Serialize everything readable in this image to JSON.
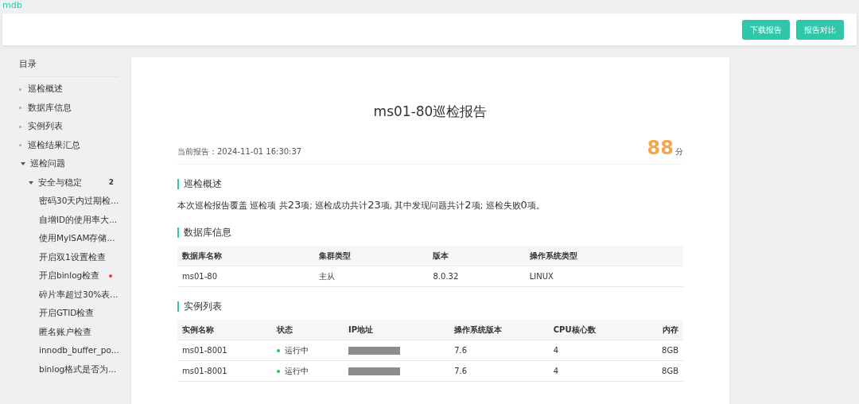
{
  "app_name": "mdb",
  "header_buttons": [
    "下载报告",
    "报告对比"
  ],
  "sidebar": {
    "title": "目录",
    "items": [
      {
        "label": "巡检概述",
        "kind": "leaf"
      },
      {
        "label": "数据库信息",
        "kind": "leaf"
      },
      {
        "label": "实例列表",
        "kind": "leaf"
      },
      {
        "label": "巡检结果汇总",
        "kind": "leaf"
      },
      {
        "label": "巡检问题",
        "kind": "group",
        "expanded": true,
        "children": [
          {
            "label": "安全与稳定",
            "kind": "group",
            "expanded": true,
            "count": "2",
            "children": [
              {
                "label": "密码30天内过期检...",
                "kind": "check",
                "alert": false
              },
              {
                "label": "自增ID的使用率大...",
                "kind": "check",
                "alert": false
              },
              {
                "label": "使用MyISAM存储...",
                "kind": "check",
                "alert": false
              },
              {
                "label": "开启双1设置检查",
                "kind": "check",
                "alert": false
              },
              {
                "label": "开启binlog检查",
                "kind": "check",
                "alert": true
              },
              {
                "label": "碎片率超过30%表...",
                "kind": "check",
                "alert": false
              },
              {
                "label": "开启GTID检查",
                "kind": "check",
                "alert": false
              },
              {
                "label": "匿名账户检查",
                "kind": "check",
                "alert": false
              },
              {
                "label": "innodb_buffer_po...",
                "kind": "check",
                "alert": false
              },
              {
                "label": "binlog格式是否为...",
                "kind": "check",
                "alert": false
              }
            ]
          }
        ]
      }
    ]
  },
  "report": {
    "title": "ms01-80巡检报告",
    "time_label": "当前报告：2024-11-01 16:30:37",
    "score": "88",
    "score_unit": "分",
    "sections": [
      {
        "kind": "summary",
        "heading": "巡检概述",
        "segments": [
          {
            "kind": "text",
            "text": "本次巡检报告覆盖 巡检项 共"
          },
          {
            "kind": "number",
            "text": "23"
          },
          {
            "kind": "text",
            "text": "项; 巡检成功共计"
          },
          {
            "kind": "number",
            "text": "23"
          },
          {
            "kind": "text",
            "text": "项, 其中发现问题共计"
          },
          {
            "kind": "number",
            "text": "2"
          },
          {
            "kind": "text",
            "text": "项; 巡检失败"
          },
          {
            "kind": "number",
            "text": "0"
          },
          {
            "kind": "text",
            "text": "项。"
          }
        ]
      },
      {
        "kind": "table",
        "heading": "数据库信息",
        "columns": [
          "数据库名称",
          "集群类型",
          "版本",
          "操作系统类型"
        ],
        "rows": [
          {
            "cells": [
              "ms01-80",
              "主从",
              "8.0.32",
              "LINUX"
            ]
          }
        ]
      },
      {
        "kind": "instances",
        "heading": "实例列表",
        "columns": [
          "实例名称",
          "状态",
          "IP地址",
          "操作系统版本",
          "CPU核心数",
          "内存"
        ],
        "rows": [
          {
            "name": "ms01-8001",
            "status": "运行中",
            "color": "#22c55e",
            "os_version": "7.6",
            "cpu": "4",
            "memory": "8GB"
          },
          {
            "name": "ms01-8001",
            "status": "运行中",
            "color": "#22c55e",
            "os_version": "7.6",
            "cpu": "4",
            "memory": "8GB"
          }
        ]
      }
    ]
  }
}
